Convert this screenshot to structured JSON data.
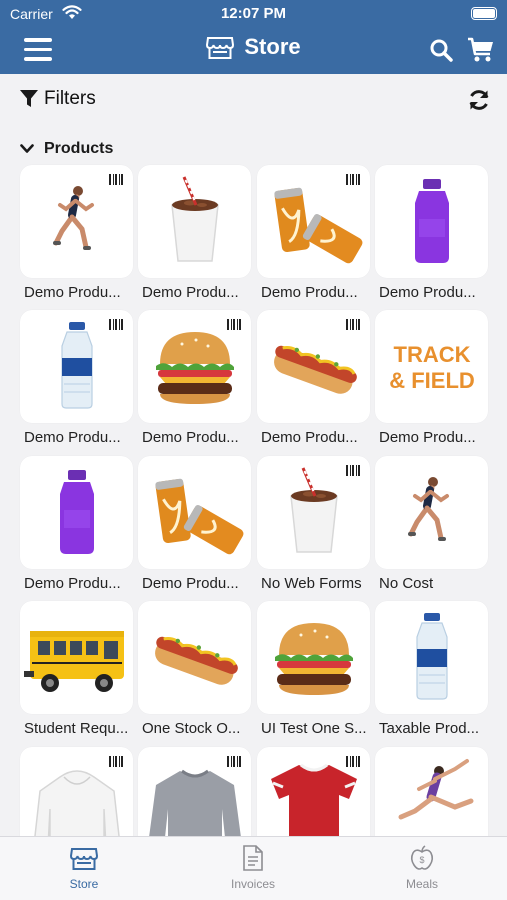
{
  "status_bar": {
    "carrier": "Carrier",
    "time": "12:07 PM"
  },
  "header": {
    "title": "Store"
  },
  "filters": {
    "label": "Filters"
  },
  "section": {
    "title": "Products"
  },
  "products": [
    {
      "label": "Demo Produ...",
      "image": "runner-icon",
      "barcode": true
    },
    {
      "label": "Demo Produ...",
      "image": "soda-cup-icon",
      "barcode": false
    },
    {
      "label": "Demo Produ...",
      "image": "energy-cans-icon",
      "barcode": true
    },
    {
      "label": "Demo Produ...",
      "image": "purple-bottle-icon",
      "barcode": false
    },
    {
      "label": "Demo Produ...",
      "image": "water-bottle-icon",
      "barcode": true
    },
    {
      "label": "Demo Produ...",
      "image": "burger-icon",
      "barcode": true
    },
    {
      "label": "Demo Produ...",
      "image": "hotdog-icon",
      "barcode": true
    },
    {
      "label": "Demo Produ...",
      "image": "track-field-logo",
      "logo_text": [
        "TRACK",
        "& FIELD"
      ],
      "barcode": false
    },
    {
      "label": "Demo Produ...",
      "image": "purple-bottle-icon",
      "barcode": false
    },
    {
      "label": "Demo Produ...",
      "image": "energy-cans-icon",
      "barcode": false
    },
    {
      "label": "No Web Forms",
      "image": "soda-cup-icon",
      "barcode": true
    },
    {
      "label": "No Cost",
      "image": "runner-icon",
      "barcode": false
    },
    {
      "label": "Student Requ...",
      "image": "school-bus-icon",
      "barcode": false
    },
    {
      "label": "One Stock O...",
      "image": "hotdog-icon",
      "barcode": false
    },
    {
      "label": "UI Test One S...",
      "image": "burger-icon",
      "barcode": false
    },
    {
      "label": "Taxable Prod...",
      "image": "water-bottle-icon",
      "barcode": false
    },
    {
      "label": "",
      "image": "hoodie-icon",
      "barcode": true
    },
    {
      "label": "",
      "image": "sweatshirt-icon",
      "barcode": true
    },
    {
      "label": "",
      "image": "tshirt-icon",
      "barcode": true
    },
    {
      "label": "",
      "image": "dancer-icon",
      "barcode": false
    }
  ],
  "tabs": [
    {
      "label": "Store",
      "icon": "store-icon",
      "active": true
    },
    {
      "label": "Invoices",
      "icon": "invoice-icon",
      "active": false
    },
    {
      "label": "Meals",
      "icon": "meals-icon",
      "active": false
    }
  ],
  "colors": {
    "brand": "#3a6ba3",
    "inactive_tab": "#8d8d92"
  }
}
